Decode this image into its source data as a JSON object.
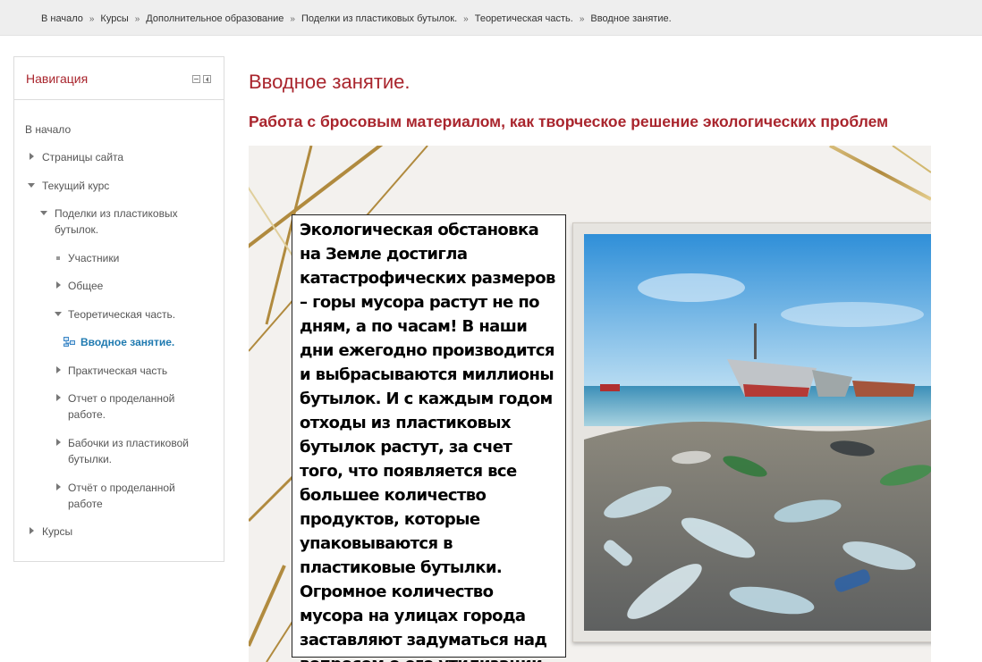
{
  "breadcrumb": {
    "items": [
      "В начало",
      "Курсы",
      "Дополнительное образование",
      "Поделки из пластиковых бутылок.",
      "Теоретическая часть.",
      "Вводное занятие."
    ],
    "separator": "»"
  },
  "navigation": {
    "title": "Навигация",
    "home": "В начало",
    "site_pages": "Страницы сайта",
    "current_course": "Текущий курс",
    "course": "Поделки из пластиковых бутылок.",
    "participants": "Участники",
    "general": "Общее",
    "theory": "Теоретическая часть.",
    "intro_lesson": "Вводное занятие.",
    "practice": "Практическая часть",
    "report1": "Отчет о проделанной работе.",
    "butterflies": "Бабочки из пластиковой бутылки.",
    "report2": "Отчёт о проделанной работе",
    "courses": "Курсы"
  },
  "page": {
    "title": "Вводное занятие.",
    "subtitle": "Работа с бросовым материалом, как творческое решение экологических проблем"
  },
  "slide": {
    "text": " Экологическая обстановка на Земле достигла катастрофических размеров – горы мусора растут не по дням, а по часам! В наши дни ежегодно производится и выбрасываются миллионы бутылок. И с каждым годом отходы из пластиковых бутылок растут, за счет того, что появляется все большее количество продуктов, которые упаковываются в пластиковые бутылки. Огромное количество мусора на улицах города заставляют задуматься над вопросом о его утилизации."
  },
  "colors": {
    "accent": "#a9252d",
    "link_active": "#1f7ab0",
    "breadcrumb_bg": "#eeeeee"
  },
  "icons": [
    "dock-icon",
    "move-icon",
    "chevron-right-icon",
    "chevron-down-icon",
    "page-icon"
  ]
}
